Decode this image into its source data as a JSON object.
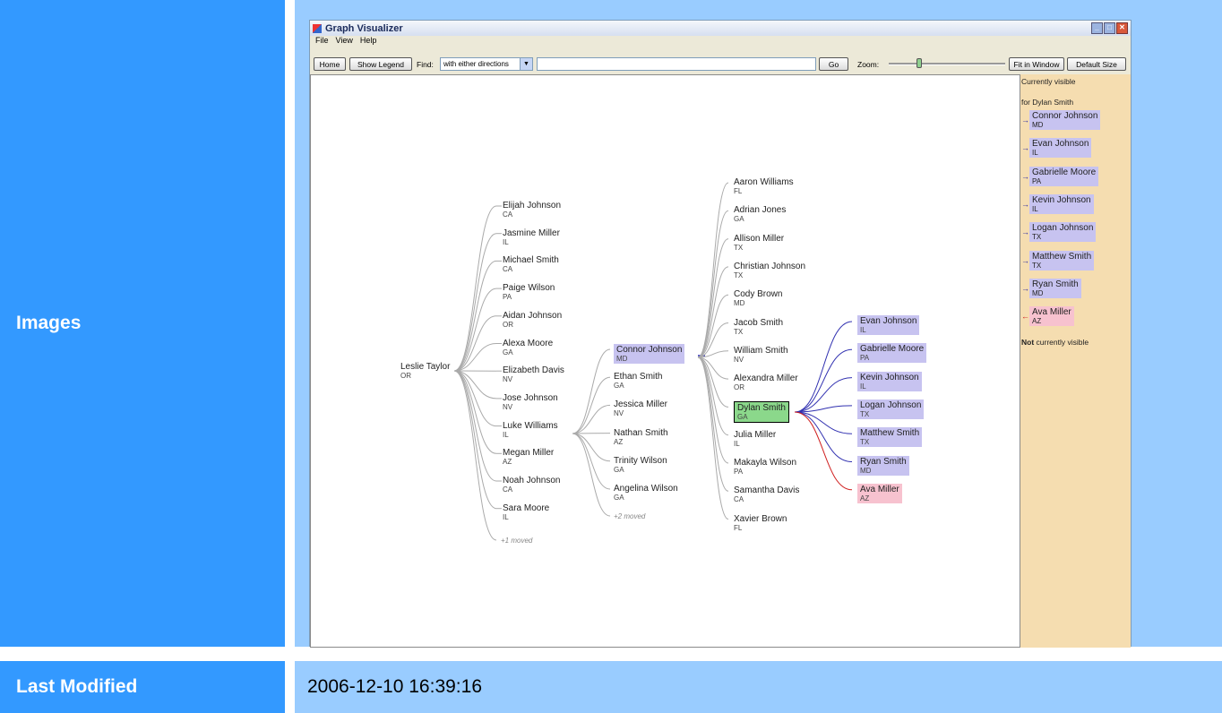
{
  "row1": {
    "label": "Images"
  },
  "row2": {
    "label": "Last Modified",
    "value": "2006-12-10 16:39:16"
  },
  "window": {
    "title": "Graph Visualizer",
    "menu": [
      "File",
      "View",
      "Help"
    ],
    "toolbar": {
      "home": "Home",
      "show_legend": "Show Legend",
      "find_label": "Find:",
      "find_mode": "with either directions",
      "find_value": "",
      "go": "Go",
      "zoom_label": "Zoom:",
      "zoom_level": 0.26,
      "fit_window": "Fit in Window",
      "default_size": "Default Size"
    }
  },
  "graph": {
    "root": {
      "name": "Leslie Taylor",
      "state": "OR"
    },
    "col1": [
      {
        "name": "Elijah Johnson",
        "state": "CA"
      },
      {
        "name": "Jasmine Miller",
        "state": "IL"
      },
      {
        "name": "Michael Smith",
        "state": "CA"
      },
      {
        "name": "Paige Wilson",
        "state": "PA"
      },
      {
        "name": "Aidan Johnson",
        "state": "OR"
      },
      {
        "name": "Alexa Moore",
        "state": "GA"
      },
      {
        "name": "Elizabeth Davis",
        "state": "NV"
      },
      {
        "name": "Jose Johnson",
        "state": "NV"
      },
      {
        "name": "Luke Williams",
        "state": "IL"
      },
      {
        "name": "Megan Miller",
        "state": "AZ"
      },
      {
        "name": "Noah Johnson",
        "state": "CA"
      },
      {
        "name": "Sara Moore",
        "state": "IL"
      }
    ],
    "col1_moved": "+1 moved",
    "col2": [
      {
        "name": "Connor Johnson",
        "state": "MD",
        "style": "blue"
      },
      {
        "name": "Ethan Smith",
        "state": "GA"
      },
      {
        "name": "Jessica Miller",
        "state": "NV"
      },
      {
        "name": "Nathan Smith",
        "state": "AZ"
      },
      {
        "name": "Trinity Wilson",
        "state": "GA"
      },
      {
        "name": "Angelina Wilson",
        "state": "GA"
      }
    ],
    "col2_moved": "+2 moved",
    "col3": [
      {
        "name": "Aaron Williams",
        "state": "FL"
      },
      {
        "name": "Adrian Jones",
        "state": "GA"
      },
      {
        "name": "Allison Miller",
        "state": "TX"
      },
      {
        "name": "Christian Johnson",
        "state": "TX"
      },
      {
        "name": "Cody Brown",
        "state": "MD"
      },
      {
        "name": "Jacob Smith",
        "state": "TX"
      },
      {
        "name": "William Smith",
        "state": "NV"
      },
      {
        "name": "Alexandra Miller",
        "state": "OR"
      },
      {
        "name": "Dylan Smith",
        "state": "GA",
        "style": "sel"
      },
      {
        "name": "Julia Miller",
        "state": "IL"
      },
      {
        "name": "Makayla Wilson",
        "state": "PA"
      },
      {
        "name": "Samantha Davis",
        "state": "CA"
      },
      {
        "name": "Xavier Brown",
        "state": "FL"
      }
    ],
    "col4": [
      {
        "name": "Evan Johnson",
        "state": "IL",
        "style": "blue"
      },
      {
        "name": "Gabrielle Moore",
        "state": "PA",
        "style": "blue"
      },
      {
        "name": "Kevin Johnson",
        "state": "IL",
        "style": "blue"
      },
      {
        "name": "Logan Johnson",
        "state": "TX",
        "style": "blue"
      },
      {
        "name": "Matthew Smith",
        "state": "TX",
        "style": "blue"
      },
      {
        "name": "Ryan Smith",
        "state": "MD",
        "style": "blue"
      },
      {
        "name": "Ava Miller",
        "state": "AZ",
        "style": "pink"
      }
    ]
  },
  "sidebar": {
    "heading": "Currently visible",
    "for_label": "for Dylan Smith",
    "items": [
      {
        "name": "Connor Johnson",
        "state": "MD",
        "style": "blue"
      },
      {
        "name": "Evan Johnson",
        "state": "IL",
        "style": "blue"
      },
      {
        "name": "Gabrielle Moore",
        "state": "PA",
        "style": "blue"
      },
      {
        "name": "Kevin Johnson",
        "state": "IL",
        "style": "blue"
      },
      {
        "name": "Logan Johnson",
        "state": "TX",
        "style": "blue"
      },
      {
        "name": "Matthew Smith",
        "state": "TX",
        "style": "blue"
      },
      {
        "name": "Ryan Smith",
        "state": "MD",
        "style": "blue"
      },
      {
        "name": "Ava Miller",
        "state": "AZ",
        "style": "pink"
      }
    ],
    "not_visible_bold": "Not",
    "not_visible_rest": " currently visible"
  }
}
